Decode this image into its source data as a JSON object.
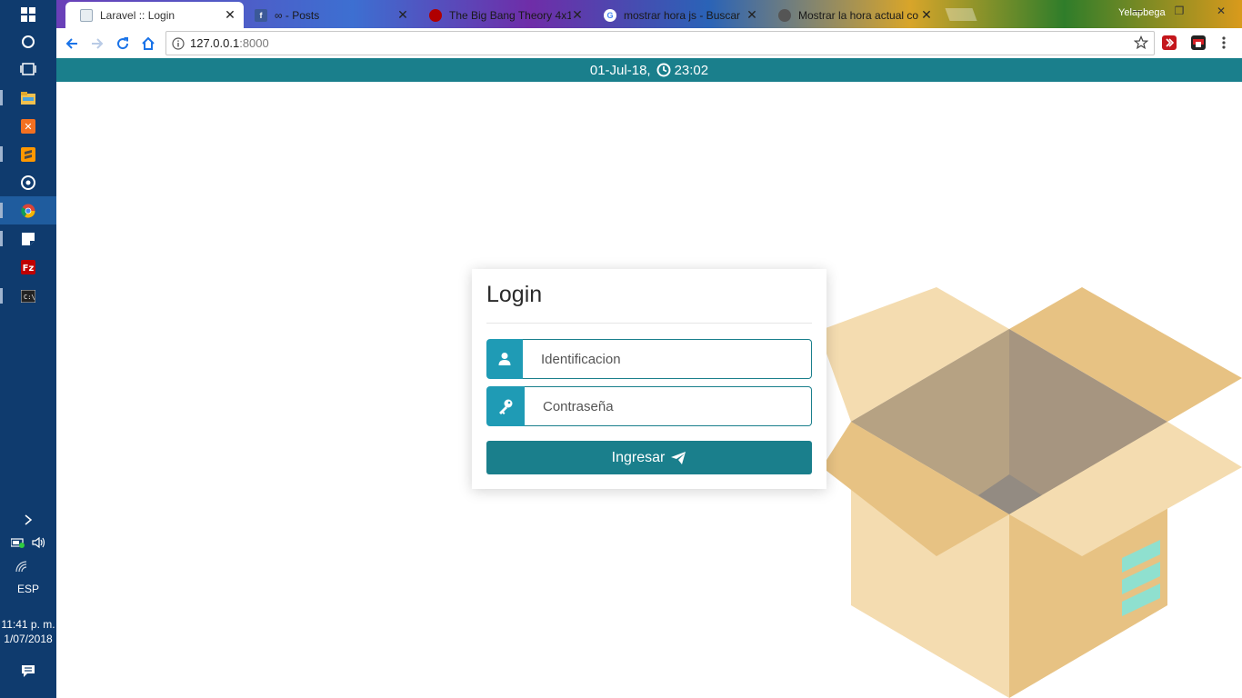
{
  "browser": {
    "tabs": [
      {
        "title": "Laravel :: Login",
        "favicon": "laravel-icon",
        "active": true
      },
      {
        "title": "∞ - Posts",
        "favicon": "facebook-icon",
        "active": false
      },
      {
        "title": "The Big Bang Theory 4x1",
        "favicon": "video-site-icon",
        "active": false
      },
      {
        "title": "mostrar hora js - Buscar",
        "favicon": "google-icon",
        "active": false
      },
      {
        "title": "Mostrar la hora actual co",
        "favicon": "site-icon",
        "active": false
      }
    ],
    "profile_name": "Yelapbega",
    "url_host": "127.0.0.1",
    "url_port": ":8000"
  },
  "header": {
    "date": "01-Jul-18,",
    "time": "23:02"
  },
  "login": {
    "title": "Login",
    "id_placeholder": "Identificacion",
    "password_placeholder": "Contraseña",
    "submit_label": "Ingresar"
  },
  "taskbar": {
    "language": "ESP",
    "clock_time": "11:41 p. m.",
    "clock_date": "1/07/2018"
  },
  "colors": {
    "accent": "#1a7f8c",
    "addon": "#1f9bb5",
    "taskbar": "#0f3b6e"
  }
}
